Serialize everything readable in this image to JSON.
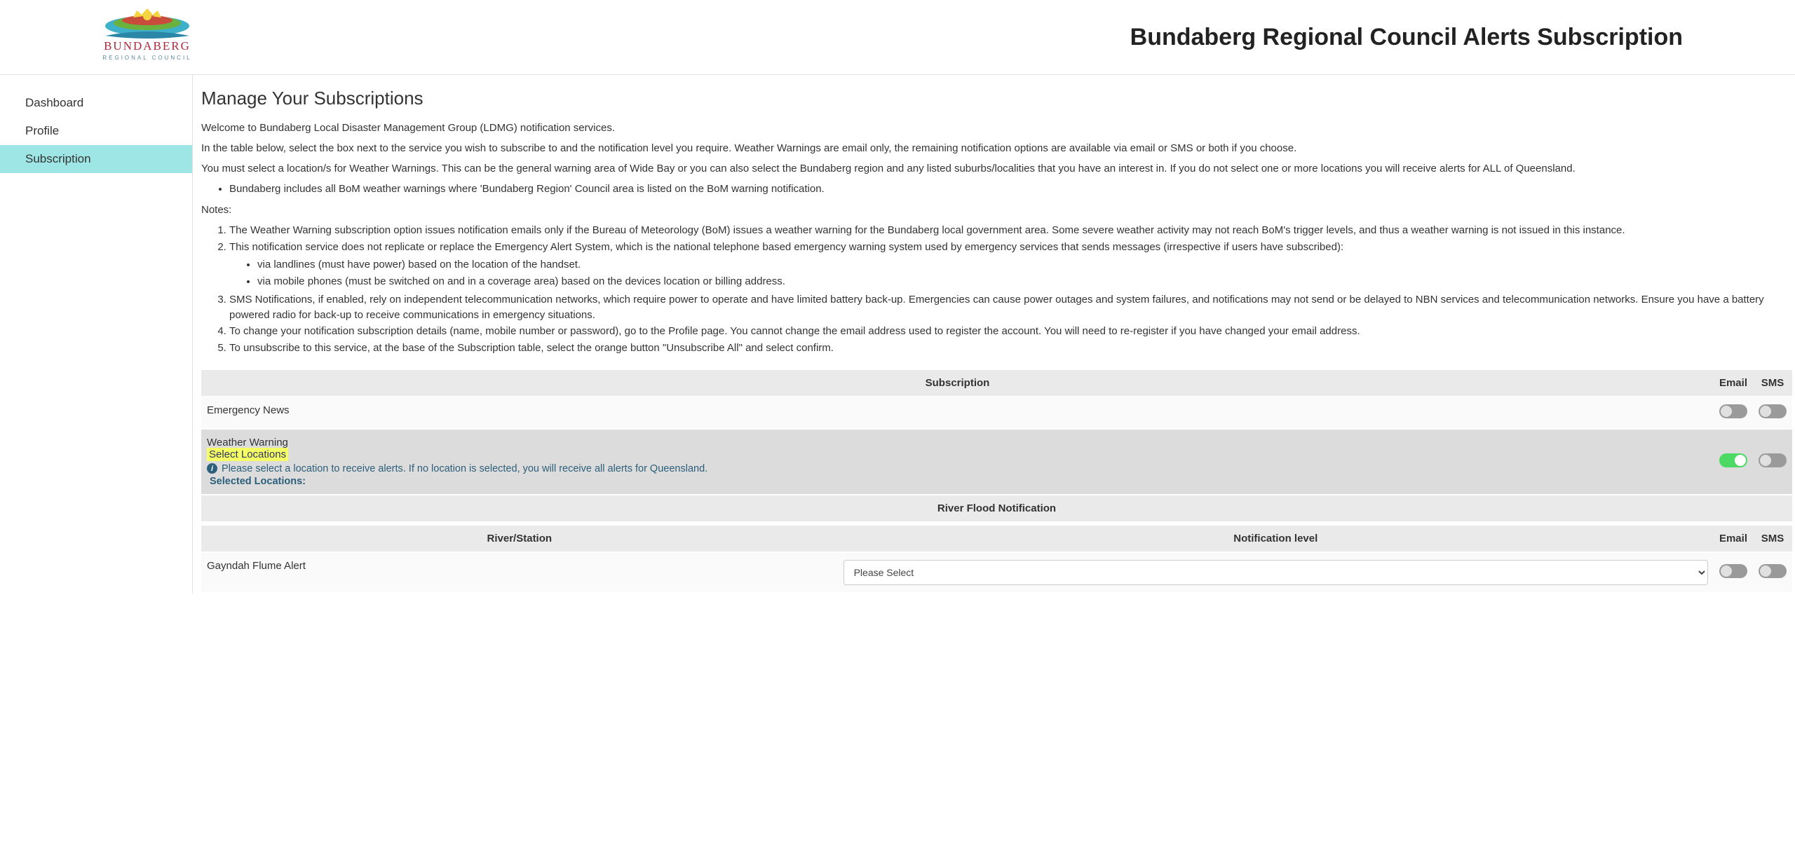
{
  "header": {
    "logo_alt": "Bundaberg Regional Council",
    "title": "Bundaberg Regional Council Alerts Subscription"
  },
  "sidebar": {
    "items": [
      {
        "label": "Dashboard",
        "active": false
      },
      {
        "label": "Profile",
        "active": false
      },
      {
        "label": "Subscription",
        "active": true
      }
    ]
  },
  "content": {
    "heading": "Manage Your Subscriptions",
    "p1": "Welcome to Bundaberg Local Disaster Management Group (LDMG) notification services.",
    "p2": "In the table below, select the box next to the service you wish to subscribe to and the notification level you require. Weather Warnings are email only, the remaining notification options are available via email or SMS or both if you choose.",
    "p3": "You must select a location/s for Weather Warnings. This can be the general warning area of Wide Bay or you can also select the Bundaberg region and any listed suburbs/localities that you have an interest in. If you do not select one or more locations you will receive alerts for ALL of Queensland.",
    "bullet1": "Bundaberg includes all BoM weather warnings where 'Bundaberg Region' Council area is listed on the BoM warning notification.",
    "notes_label": "Notes:",
    "notes": [
      "The Weather Warning subscription option issues notification emails only if the Bureau of Meteorology (BoM) issues a weather warning for the Bundaberg local government area. Some severe weather activity may not reach BoM's trigger levels, and thus a weather warning is not issued in this instance.",
      "This notification service does not replicate or replace the Emergency Alert System, which is the national telephone based emergency warning system used by emergency services that sends messages (irrespective if users have subscribed):",
      "SMS Notifications, if enabled, rely on independent telecommunication networks, which require power to operate and have limited battery back-up. Emergencies can cause power outages and system failures, and notifications may not send or be delayed to NBN services and telecommunication networks. Ensure you have a battery powered radio for back-up to receive communications in emergency situations.",
      "To change your notification subscription details (name, mobile number or password), go to the Profile page. You cannot change the email address used to register the account. You will need to re-register if you have changed your email address.",
      "To unsubscribe to this service, at the base of the Subscription table, select the orange button \"Unsubscribe All\" and select confirm."
    ],
    "note2_sub": [
      "via landlines (must have power) based on the location of the handset.",
      "via mobile phones (must be switched on and in a coverage area) based on the devices location or billing address."
    ]
  },
  "table": {
    "headers": {
      "subscription": "Subscription",
      "email": "Email",
      "sms": "SMS"
    },
    "rows": [
      {
        "name": "Emergency News",
        "email_on": false,
        "sms_on": false
      },
      {
        "name": "Weather Warning",
        "email_on": true,
        "sms_on": false,
        "select_locations": "Select Locations",
        "info_text": "Please select a location to receive alerts. If no location is selected, you will receive all alerts for Queensland.",
        "selected_label": "Selected Locations:"
      }
    ],
    "river_section": {
      "title": "River Flood Notification",
      "headers": {
        "river": "River/Station",
        "level": "Notification level",
        "email": "Email",
        "sms": "SMS"
      },
      "rows": [
        {
          "station": "Gayndah Flume Alert",
          "level_placeholder": "Please Select",
          "email_on": false,
          "sms_on": false
        }
      ]
    }
  }
}
